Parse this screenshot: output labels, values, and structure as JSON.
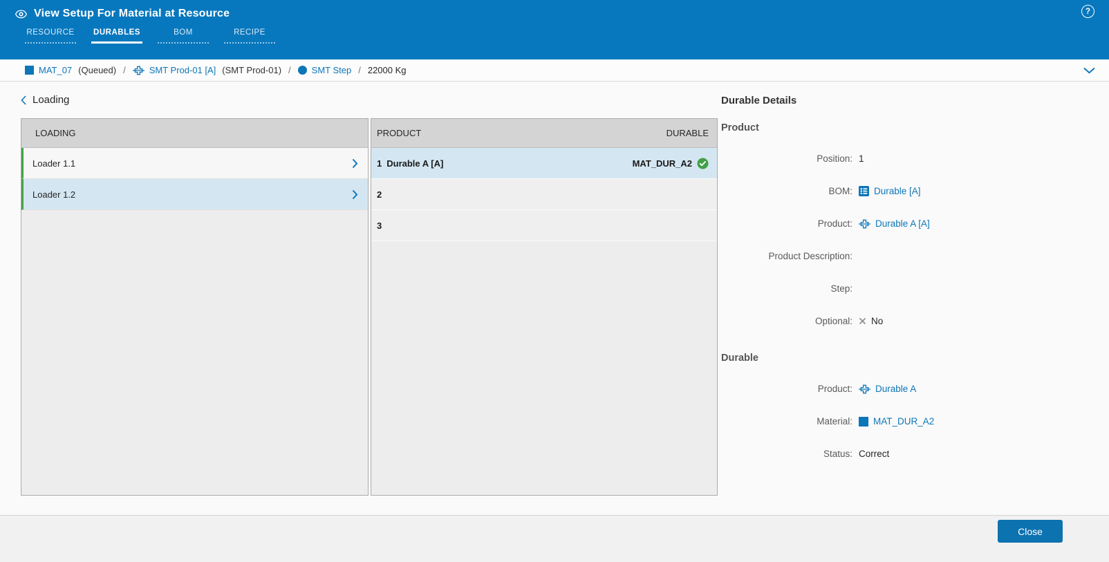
{
  "colors": {
    "header_blue": "#0878be",
    "accent_blue": "#0d76b8",
    "selected_row_blue": "#d4e6f1",
    "success_green": "#43a047",
    "loader_row_green": "#44a544",
    "table_header_gray": "#d4d4d4"
  },
  "header": {
    "title": "View Setup For Material at Resource",
    "help_glyph": "?",
    "tabs": [
      {
        "label": "RESOURCE",
        "active": false
      },
      {
        "label": "DURABLES",
        "active": true
      },
      {
        "label": "BOM",
        "active": false
      },
      {
        "label": "RECIPE",
        "active": false
      }
    ]
  },
  "breadcrumb": {
    "separator": "/",
    "items": [
      {
        "icon": "material-icon",
        "label": "MAT_07",
        "note": "(Queued)"
      },
      {
        "icon": "product-icon",
        "label": "SMT Prod-01 [A]",
        "note": "(SMT Prod-01)"
      },
      {
        "icon": "step-icon",
        "label": "SMT Step",
        "note": ""
      },
      {
        "icon": "",
        "label": "22000 Kg",
        "note": ""
      }
    ]
  },
  "loading_panel": {
    "back_label": "Loading",
    "loading_table": {
      "header": "LOADING",
      "rows": [
        {
          "label": "Loader 1.1",
          "selected": false
        },
        {
          "label": "Loader 1.2",
          "selected": true
        }
      ]
    },
    "product_table": {
      "col_product": "PRODUCT",
      "col_durable": "DURABLE",
      "rows": [
        {
          "num": "1",
          "product": "Durable A [A]",
          "durable": "MAT_DUR_A2",
          "status": "ok",
          "selected": true
        },
        {
          "num": "2",
          "product": "",
          "durable": "",
          "status": "",
          "selected": false
        },
        {
          "num": "3",
          "product": "",
          "durable": "",
          "status": "",
          "selected": false
        }
      ]
    }
  },
  "details": {
    "title": "Durable Details",
    "sections": [
      {
        "title": "Product",
        "fields": [
          {
            "label": "Position:",
            "value": "1"
          },
          {
            "label": "BOM:",
            "value": "Durable [A]",
            "icon": "bom-icon",
            "link": true
          },
          {
            "label": "Product:",
            "value": "Durable A [A]",
            "icon": "product-icon",
            "link": true
          },
          {
            "label": "Product Description:",
            "value": ""
          },
          {
            "label": "Step:",
            "value": ""
          },
          {
            "label": "Optional:",
            "value": "No",
            "icon": "x-icon"
          }
        ]
      },
      {
        "title": "Durable",
        "fields": [
          {
            "label": "Product:",
            "value": "Durable A",
            "icon": "product-icon",
            "link": true
          },
          {
            "label": "Material:",
            "value": "MAT_DUR_A2",
            "icon": "material-icon",
            "link": true
          },
          {
            "label": "Status:",
            "value": "Correct"
          }
        ]
      }
    ]
  },
  "footer": {
    "close_label": "Close"
  }
}
